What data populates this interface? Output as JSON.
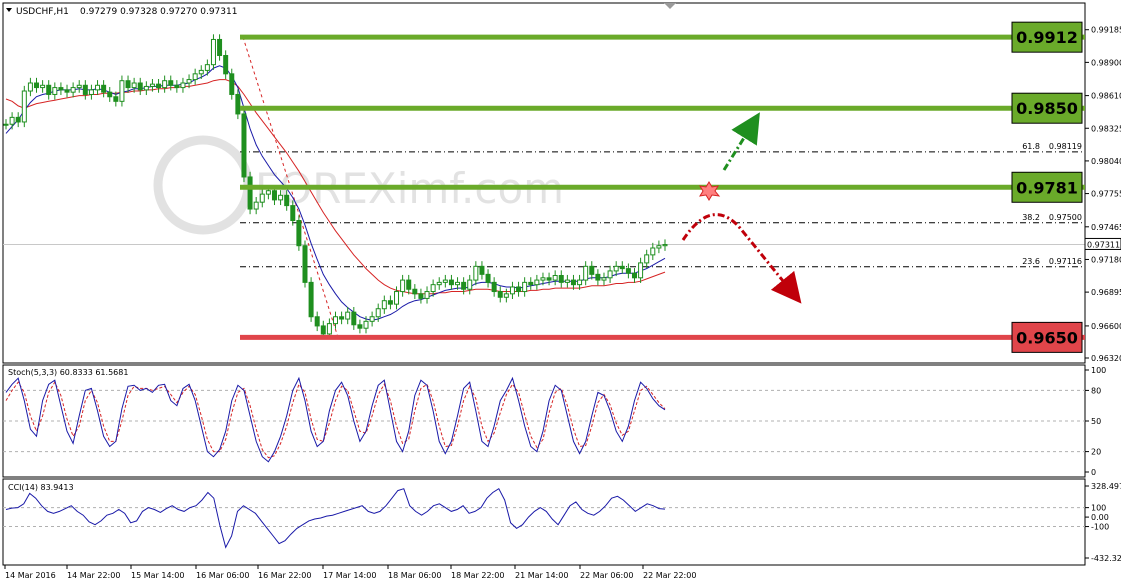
{
  "header": {
    "symbol": "USDCHF,H1",
    "ohlc": "0.97279 0.97328 0.97270 0.97311"
  },
  "chart_data": [
    {
      "type": "line",
      "panel": "price",
      "ylim": [
        0.9632,
        0.992
      ],
      "price_axis_ticks": [
        "0.99185",
        "0.98900",
        "0.98610",
        "0.98325",
        "0.98040",
        "0.97755",
        "0.97465",
        "0.97180",
        "0.96895",
        "0.96600",
        "0.96320"
      ],
      "current_price": "0.97311",
      "levels": [
        {
          "label": "0.9912",
          "value": 0.9912,
          "color": "#6aaa2a"
        },
        {
          "label": "0.9850",
          "value": 0.985,
          "color": "#6aaa2a"
        },
        {
          "label": "0.9781",
          "value": 0.9781,
          "color": "#6aaa2a"
        },
        {
          "label": "0.9650",
          "value": 0.965,
          "color": "#e0454a"
        }
      ],
      "fibonacci": [
        {
          "ratio": "61.8",
          "price": "0.98119",
          "value": 0.98119
        },
        {
          "ratio": "38.2",
          "price": "0.97500",
          "value": 0.975
        },
        {
          "ratio": "23.6",
          "price": "0.97116",
          "value": 0.97116
        }
      ],
      "close_series": [
        0.9836,
        0.9842,
        0.9838,
        0.9865,
        0.9872,
        0.9868,
        0.987,
        0.9862,
        0.9868,
        0.9866,
        0.9864,
        0.9868,
        0.987,
        0.9862,
        0.9866,
        0.987,
        0.9864,
        0.986,
        0.9856,
        0.9874,
        0.9868,
        0.9872,
        0.9866,
        0.9869,
        0.9871,
        0.9868,
        0.9874,
        0.987,
        0.9868,
        0.9872,
        0.9875,
        0.988,
        0.9883,
        0.9888,
        0.991,
        0.9896,
        0.988,
        0.9862,
        0.9845,
        0.979,
        0.9762,
        0.9768,
        0.9775,
        0.9778,
        0.977,
        0.9774,
        0.9765,
        0.9752,
        0.973,
        0.9698,
        0.9668,
        0.966,
        0.9653,
        0.9662,
        0.9668,
        0.9666,
        0.9672,
        0.9661,
        0.9658,
        0.9664,
        0.9668,
        0.9675,
        0.9682,
        0.9679,
        0.969,
        0.97,
        0.9692,
        0.9688,
        0.9684,
        0.969,
        0.9696,
        0.9698,
        0.97,
        0.9696,
        0.9698,
        0.9692,
        0.97,
        0.9712,
        0.9705,
        0.9698,
        0.969,
        0.9685,
        0.9688,
        0.9694,
        0.969,
        0.9698,
        0.9696,
        0.97,
        0.9702,
        0.97,
        0.9704,
        0.9698,
        0.97,
        0.9696,
        0.97,
        0.9712,
        0.9705,
        0.97,
        0.9702,
        0.9708,
        0.9712,
        0.971,
        0.9706,
        0.9702,
        0.9715,
        0.9722,
        0.9728,
        0.973,
        0.9731
      ],
      "ma_fast": [
        0.9828,
        0.9834,
        0.984,
        0.9848,
        0.9855,
        0.986,
        0.9862,
        0.9863,
        0.9865,
        0.9866,
        0.9866,
        0.9866,
        0.9867,
        0.9866,
        0.9866,
        0.9867,
        0.9866,
        0.9864,
        0.9862,
        0.9864,
        0.9865,
        0.9867,
        0.9867,
        0.9868,
        0.9869,
        0.9869,
        0.987,
        0.987,
        0.987,
        0.9871,
        0.9872,
        0.9875,
        0.9877,
        0.988,
        0.9885,
        0.9887,
        0.9885,
        0.9878,
        0.9868,
        0.985,
        0.9832,
        0.9818,
        0.9808,
        0.98,
        0.9792,
        0.9786,
        0.978,
        0.9772,
        0.9762,
        0.9748,
        0.9732,
        0.9718,
        0.9705,
        0.9696,
        0.9688,
        0.9681,
        0.9676,
        0.9672,
        0.9668,
        0.9666,
        0.9665,
        0.9666,
        0.9668,
        0.967,
        0.9673,
        0.9677,
        0.968,
        0.9682,
        0.9683,
        0.9685,
        0.9687,
        0.9689,
        0.9691,
        0.9692,
        0.9693,
        0.9693,
        0.9694,
        0.9697,
        0.9698,
        0.9698,
        0.9697,
        0.9695,
        0.9694,
        0.9694,
        0.9693,
        0.9694,
        0.9695,
        0.9696,
        0.9697,
        0.9698,
        0.9699,
        0.9699,
        0.9699,
        0.9699,
        0.9699,
        0.9701,
        0.9702,
        0.9702,
        0.9702,
        0.9703,
        0.9705,
        0.9706,
        0.9706,
        0.9706,
        0.9708,
        0.971,
        0.9713,
        0.9716,
        0.9719
      ],
      "ma_slow": [
        0.9858,
        0.9856,
        0.9852,
        0.985,
        0.9852,
        0.9854,
        0.9855,
        0.9856,
        0.9857,
        0.9858,
        0.9859,
        0.986,
        0.9861,
        0.9861,
        0.9862,
        0.9862,
        0.9863,
        0.9863,
        0.9863,
        0.9864,
        0.9864,
        0.9865,
        0.9865,
        0.9866,
        0.9866,
        0.9867,
        0.9867,
        0.9868,
        0.9868,
        0.9869,
        0.9869,
        0.987,
        0.9871,
        0.9872,
        0.9874,
        0.9875,
        0.9875,
        0.9873,
        0.9869,
        0.9862,
        0.9854,
        0.9846,
        0.9839,
        0.9832,
        0.9825,
        0.9818,
        0.9811,
        0.9803,
        0.9795,
        0.9786,
        0.9777,
        0.9768,
        0.9759,
        0.9751,
        0.9743,
        0.9736,
        0.9729,
        0.9722,
        0.9716,
        0.971,
        0.9705,
        0.97,
        0.9696,
        0.9693,
        0.9691,
        0.969,
        0.9689,
        0.9688,
        0.9688,
        0.9688,
        0.9688,
        0.9689,
        0.9689,
        0.969,
        0.969,
        0.969,
        0.9691,
        0.9692,
        0.9692,
        0.9692,
        0.9691,
        0.969,
        0.969,
        0.969,
        0.969,
        0.969,
        0.9691,
        0.9691,
        0.9692,
        0.9692,
        0.9693,
        0.9693,
        0.9693,
        0.9693,
        0.9693,
        0.9694,
        0.9695,
        0.9695,
        0.9695,
        0.9696,
        0.9697,
        0.9697,
        0.9698,
        0.9698,
        0.9699,
        0.9701,
        0.9703,
        0.9705,
        0.9707
      ]
    },
    {
      "type": "line",
      "panel": "stochastic",
      "label": "Stoch(5,3,3) 60.8333 61.5681",
      "ylim": [
        0,
        100
      ],
      "ticks": [
        "100",
        "80",
        "50",
        "20",
        "0"
      ],
      "main": [
        78,
        86,
        92,
        70,
        42,
        35,
        70,
        86,
        90,
        65,
        40,
        28,
        55,
        80,
        82,
        60,
        35,
        25,
        30,
        62,
        84,
        85,
        80,
        82,
        78,
        85,
        86,
        70,
        65,
        82,
        86,
        70,
        45,
        20,
        15,
        22,
        40,
        70,
        85,
        80,
        55,
        30,
        15,
        10,
        20,
        35,
        55,
        80,
        92,
        70,
        40,
        25,
        30,
        60,
        80,
        88,
        75,
        50,
        30,
        40,
        65,
        85,
        90,
        60,
        30,
        20,
        40,
        75,
        90,
        85,
        60,
        30,
        18,
        30,
        55,
        82,
        88,
        60,
        30,
        25,
        45,
        70,
        80,
        92,
        70,
        45,
        25,
        20,
        40,
        70,
        85,
        80,
        55,
        30,
        18,
        30,
        55,
        78,
        75,
        60,
        40,
        30,
        45,
        70,
        88,
        82,
        72,
        65,
        61
      ],
      "signal": [
        70,
        80,
        88,
        78,
        55,
        40,
        55,
        78,
        88,
        75,
        52,
        35,
        45,
        70,
        80,
        68,
        45,
        30,
        30,
        50,
        75,
        84,
        82,
        82,
        80,
        82,
        84,
        76,
        68,
        78,
        84,
        76,
        55,
        32,
        20,
        20,
        32,
        58,
        78,
        82,
        65,
        42,
        22,
        14,
        16,
        28,
        45,
        68,
        86,
        78,
        52,
        32,
        30,
        48,
        70,
        84,
        80,
        60,
        40,
        38,
        55,
        76,
        86,
        70,
        45,
        28,
        32,
        60,
        82,
        86,
        70,
        45,
        25,
        26,
        45,
        70,
        84,
        72,
        45,
        30,
        38,
        58,
        76,
        86,
        78,
        56,
        35,
        24,
        32,
        58,
        78,
        82,
        65,
        42,
        25,
        26,
        45,
        68,
        76,
        66,
        48,
        36,
        40,
        60,
        80,
        84,
        76,
        68,
        62
      ]
    },
    {
      "type": "line",
      "panel": "cci",
      "label": "CCI(14) 83.9413",
      "ylim": [
        -432.3,
        328.5
      ],
      "ticks": [
        "328.4972",
        "100",
        "0.00",
        "-100",
        "-432.32"
      ],
      "values": [
        80,
        95,
        100,
        140,
        250,
        200,
        120,
        60,
        40,
        60,
        90,
        120,
        60,
        20,
        -50,
        -80,
        -40,
        20,
        40,
        80,
        40,
        -60,
        -40,
        60,
        100,
        80,
        50,
        90,
        120,
        80,
        60,
        100,
        120,
        180,
        260,
        200,
        -80,
        -320,
        -200,
        60,
        120,
        80,
        40,
        -40,
        -120,
        -200,
        -280,
        -250,
        -180,
        -120,
        -80,
        -40,
        -20,
        -10,
        10,
        20,
        40,
        60,
        80,
        100,
        120,
        60,
        40,
        60,
        120,
        200,
        280,
        300,
        120,
        60,
        20,
        60,
        120,
        140,
        100,
        60,
        80,
        120,
        40,
        60,
        100,
        200,
        260,
        300,
        180,
        -60,
        -120,
        -80,
        0,
        60,
        100,
        60,
        -20,
        -80,
        20,
        120,
        160,
        80,
        40,
        20,
        60,
        120,
        200,
        220,
        180,
        120,
        60,
        100,
        140,
        120,
        90,
        84
      ]
    }
  ],
  "time_axis": [
    "14 Mar 2016",
    "14 Mar 22:00",
    "15 Mar 14:00",
    "16 Mar 06:00",
    "16 Mar 22:00",
    "17 Mar 14:00",
    "18 Mar 06:00",
    "18 Mar 22:00",
    "21 Mar 14:00",
    "22 Mar 06:00",
    "22 Mar 22:00"
  ],
  "watermark": "FOREXimf.com",
  "colors": {
    "candle": "#1f8f1f",
    "ma_fast": "#1a1aa8",
    "ma_slow": "#d62424",
    "stoch_main": "#1a1aa8",
    "stoch_signal": "#d62424",
    "cci": "#1a1aa8",
    "bullish_arrow": "#1f8f1f",
    "bearish_arrow": "#c0000a"
  }
}
